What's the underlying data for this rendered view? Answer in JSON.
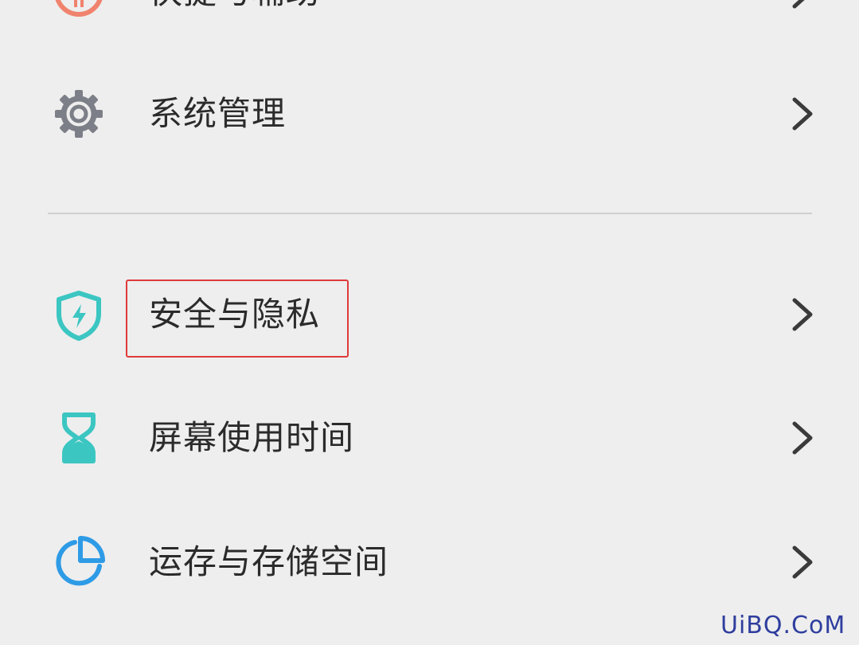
{
  "settings": {
    "items": [
      {
        "label": "快捷与辅助",
        "icon": "shortcut-icon",
        "color": "#f0836e"
      },
      {
        "label": "系统管理",
        "icon": "gear-icon",
        "color": "#7c7f87"
      },
      {
        "label": "安全与隐私",
        "icon": "shield-bolt-icon",
        "color": "#3cc6c2"
      },
      {
        "label": "屏幕使用时间",
        "icon": "hourglass-icon",
        "color": "#3cc6c2"
      },
      {
        "label": "运存与存储空间",
        "icon": "pie-chart-icon",
        "color": "#2e9be6"
      }
    ]
  },
  "watermark": {
    "text": "UiBQ.CoM"
  },
  "colors": {
    "background": "#eeeeee",
    "highlight": "#e03a3a",
    "divider": "#cfcfcf",
    "chevron": "#3a3a3a"
  }
}
